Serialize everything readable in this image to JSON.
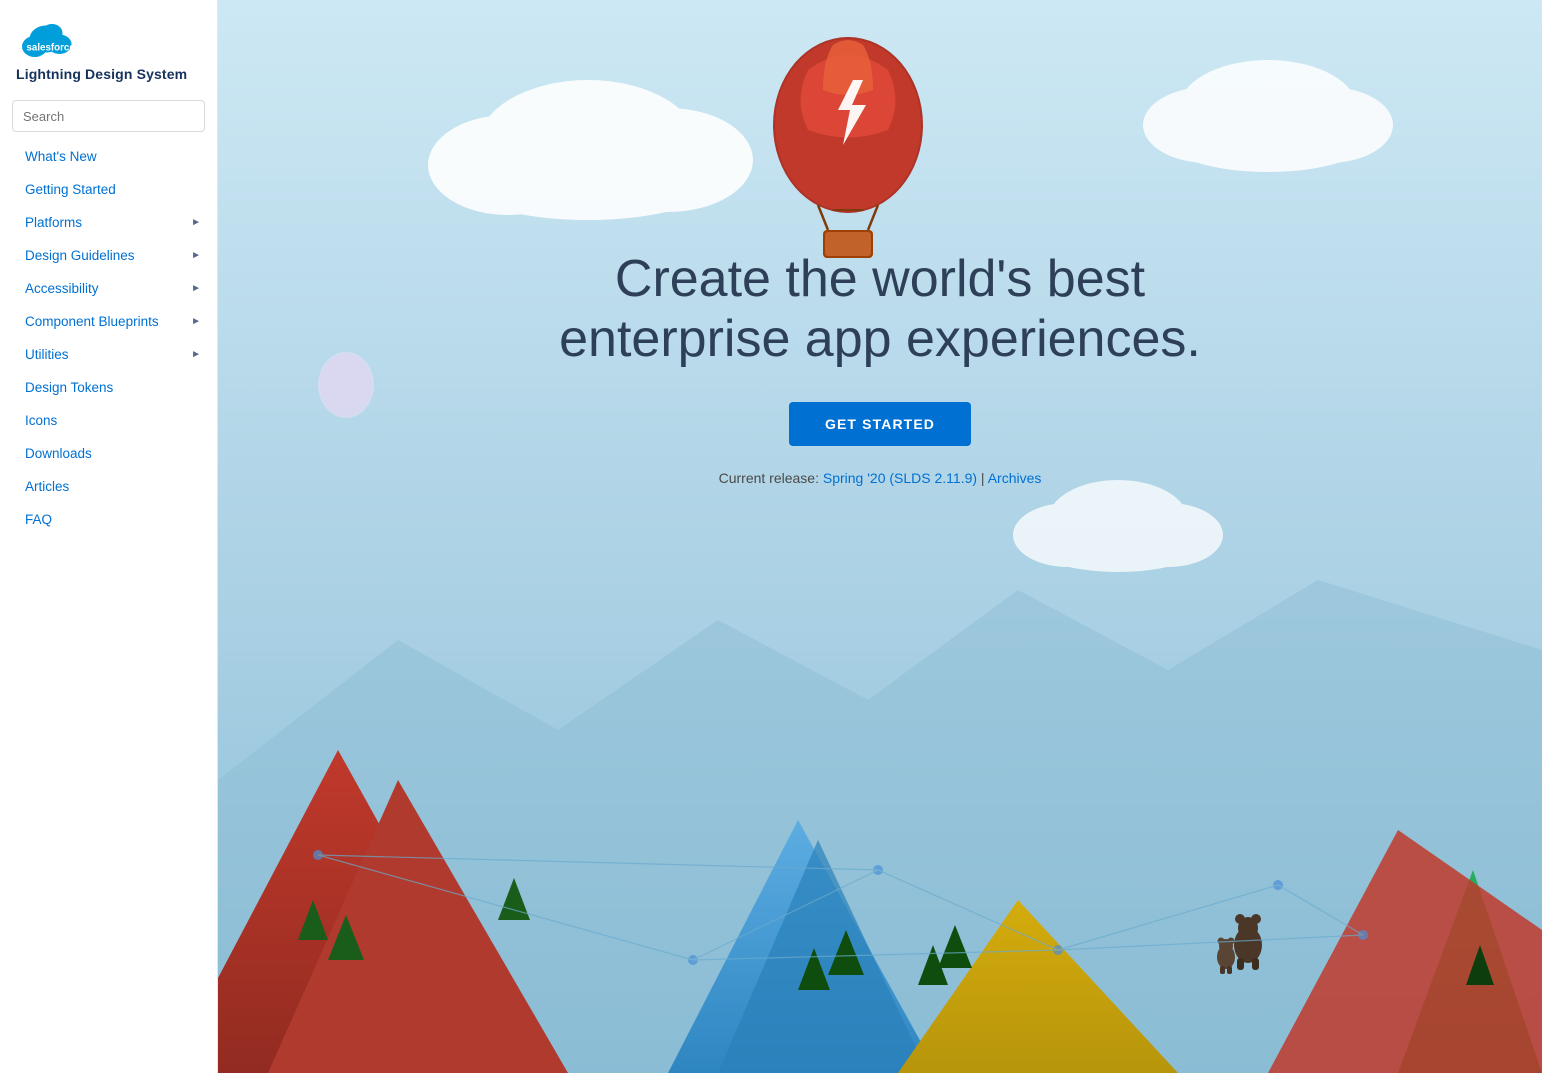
{
  "sidebar": {
    "logo_text": "salesforce",
    "title": "Lightning Design System",
    "search": {
      "placeholder": "Search"
    },
    "nav_items": [
      {
        "id": "whats-new",
        "label": "What's New",
        "has_arrow": false
      },
      {
        "id": "getting-started",
        "label": "Getting Started",
        "has_arrow": false
      },
      {
        "id": "platforms",
        "label": "Platforms",
        "has_arrow": true
      },
      {
        "id": "design-guidelines",
        "label": "Design Guidelines",
        "has_arrow": true
      },
      {
        "id": "accessibility",
        "label": "Accessibility",
        "has_arrow": true
      },
      {
        "id": "component-blueprints",
        "label": "Component Blueprints",
        "has_arrow": true
      },
      {
        "id": "utilities",
        "label": "Utilities",
        "has_arrow": true
      },
      {
        "id": "design-tokens",
        "label": "Design Tokens",
        "has_arrow": false
      },
      {
        "id": "icons",
        "label": "Icons",
        "has_arrow": false
      },
      {
        "id": "downloads",
        "label": "Downloads",
        "has_arrow": false
      },
      {
        "id": "articles",
        "label": "Articles",
        "has_arrow": false
      },
      {
        "id": "faq",
        "label": "FAQ",
        "has_arrow": false
      }
    ]
  },
  "hero": {
    "title_line1": "Create the world's best",
    "title_line2": "enterprise app experiences.",
    "cta_button": "GET STARTED",
    "release_prefix": "Current release: ",
    "release_link": "Spring '20 (SLDS 2.11.9)",
    "release_separator": " | ",
    "archives_link": "Archives"
  },
  "colors": {
    "salesforce_blue": "#0070d2",
    "sidebar_bg": "#ffffff",
    "hero_bg_top": "#c9e4f0",
    "hero_bg_bottom": "#8bbdd8",
    "title_color": "#2e4057",
    "nav_text": "#0070d2"
  }
}
